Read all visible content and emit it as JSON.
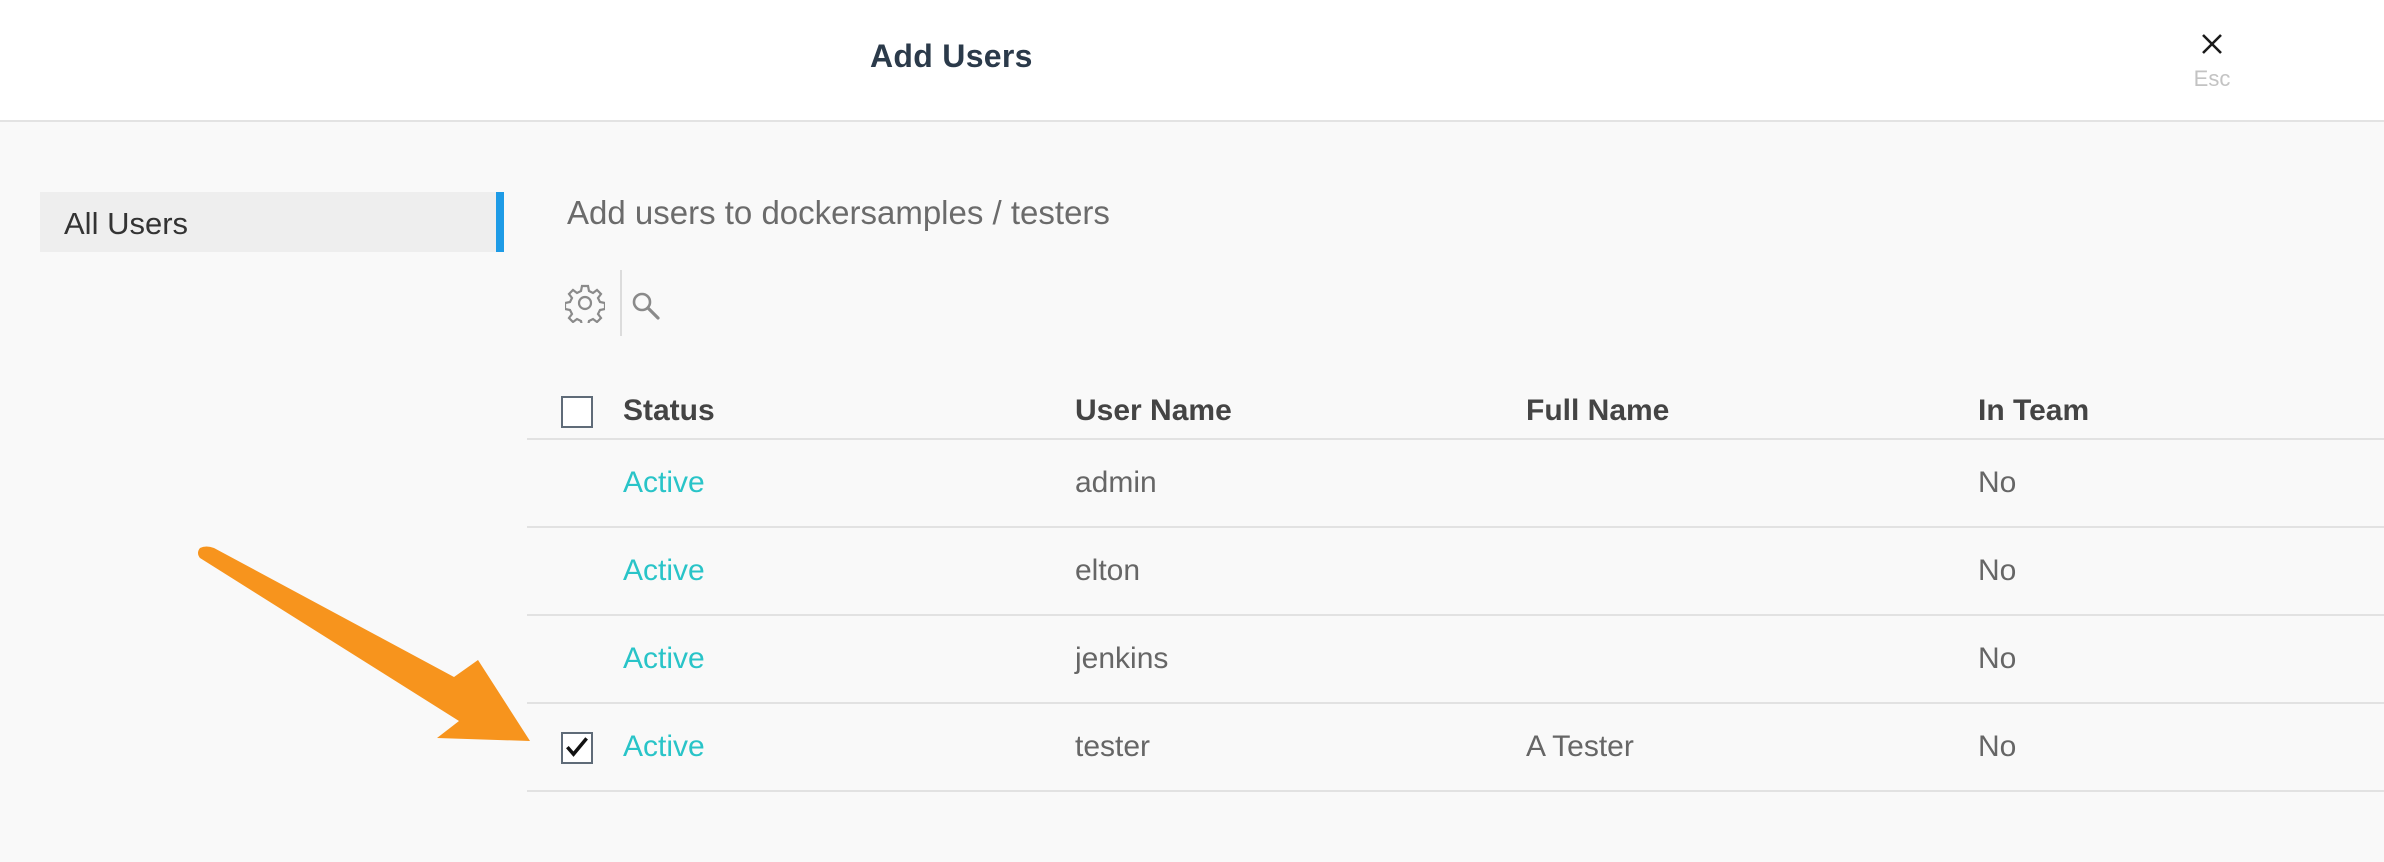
{
  "header": {
    "title": "Add Users",
    "close_hint": "Esc"
  },
  "sidebar": {
    "items": [
      {
        "label": "All Users",
        "active": true
      }
    ]
  },
  "main": {
    "subtitle": "Add users to dockersamples / testers",
    "toolbar": {
      "settings_icon": "gear-icon",
      "search_icon": "search-icon"
    },
    "table": {
      "columns": [
        "Status",
        "User Name",
        "Full Name",
        "In Team"
      ],
      "rows": [
        {
          "status": "Active",
          "user_name": "admin",
          "full_name": "",
          "in_team": "No",
          "selected": false
        },
        {
          "status": "Active",
          "user_name": "elton",
          "full_name": "",
          "in_team": "No",
          "selected": false
        },
        {
          "status": "Active",
          "user_name": "jenkins",
          "full_name": "",
          "in_team": "No",
          "selected": false
        },
        {
          "status": "Active",
          "user_name": "tester",
          "full_name": "A Tester",
          "in_team": "No",
          "selected": true
        }
      ]
    }
  },
  "colors": {
    "accent": "#1e9be6",
    "status_active": "#29c4c8",
    "annotation_arrow": "#f7941d"
  }
}
